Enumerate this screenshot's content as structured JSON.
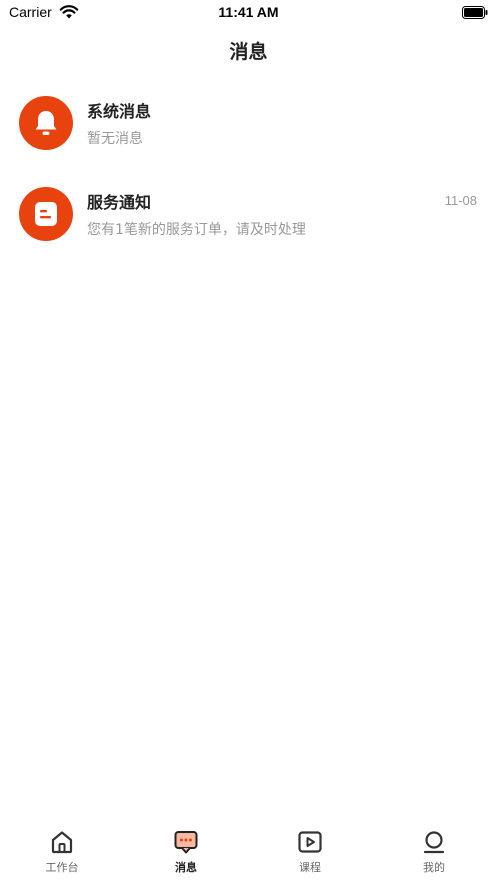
{
  "status_bar": {
    "carrier": "Carrier",
    "time": "11:41 AM"
  },
  "header": {
    "title": "消息"
  },
  "messages": [
    {
      "title": "系统消息",
      "subtitle": "暂无消息",
      "time": "",
      "icon": "bell-icon"
    },
    {
      "title": "服务通知",
      "subtitle": "您有1笔新的服务订单，请及时处理",
      "time": "11-08",
      "icon": "notice-icon"
    }
  ],
  "tabs": [
    {
      "label": "工作台",
      "icon": "home-icon",
      "active": false
    },
    {
      "label": "消息",
      "icon": "message-icon",
      "active": true
    },
    {
      "label": "课程",
      "icon": "video-icon",
      "active": false
    },
    {
      "label": "我的",
      "icon": "user-icon",
      "active": false
    }
  ],
  "colors": {
    "accent": "#e8420f",
    "text": "#222222",
    "muted": "#999999"
  }
}
